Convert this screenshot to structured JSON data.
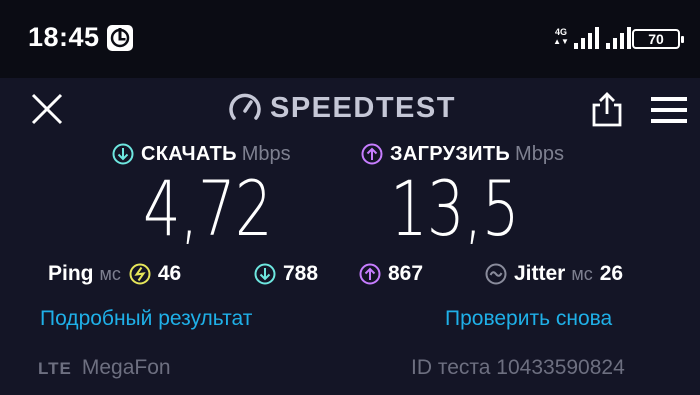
{
  "status_bar": {
    "time": "18:45",
    "network_type": "4G",
    "battery": "70",
    "icons": [
      "app-notification-icon",
      "signal-icon",
      "signal-icon-sim2",
      "battery-icon"
    ]
  },
  "header": {
    "logo_text": "SPEEDTEST",
    "icons": [
      "close-icon",
      "speedometer-icon",
      "share-icon",
      "menu-icon"
    ]
  },
  "download": {
    "label": "СКАЧАТЬ",
    "unit": "Mbps",
    "value": "4,72",
    "color": "#6ee7e0"
  },
  "upload": {
    "label": "ЗАГРУЗИТЬ",
    "unit": "Mbps",
    "value": "13,5",
    "color": "#c77dff"
  },
  "stats": {
    "ping_label": "Ping",
    "ping_unit": "мс",
    "ping_value": "46",
    "ping_color": "#e6e65a",
    "download_latency": "788",
    "upload_latency": "867",
    "jitter_label": "Jitter",
    "jitter_unit": "мс",
    "jitter_value": "26"
  },
  "actions": {
    "details_link": "Подробный результат",
    "retest_link": "Проверить снова",
    "link_color": "#1fb0e8"
  },
  "footer": {
    "network": "LTE",
    "provider": "MegaFon",
    "test_id": "ID теста 10433590824"
  }
}
